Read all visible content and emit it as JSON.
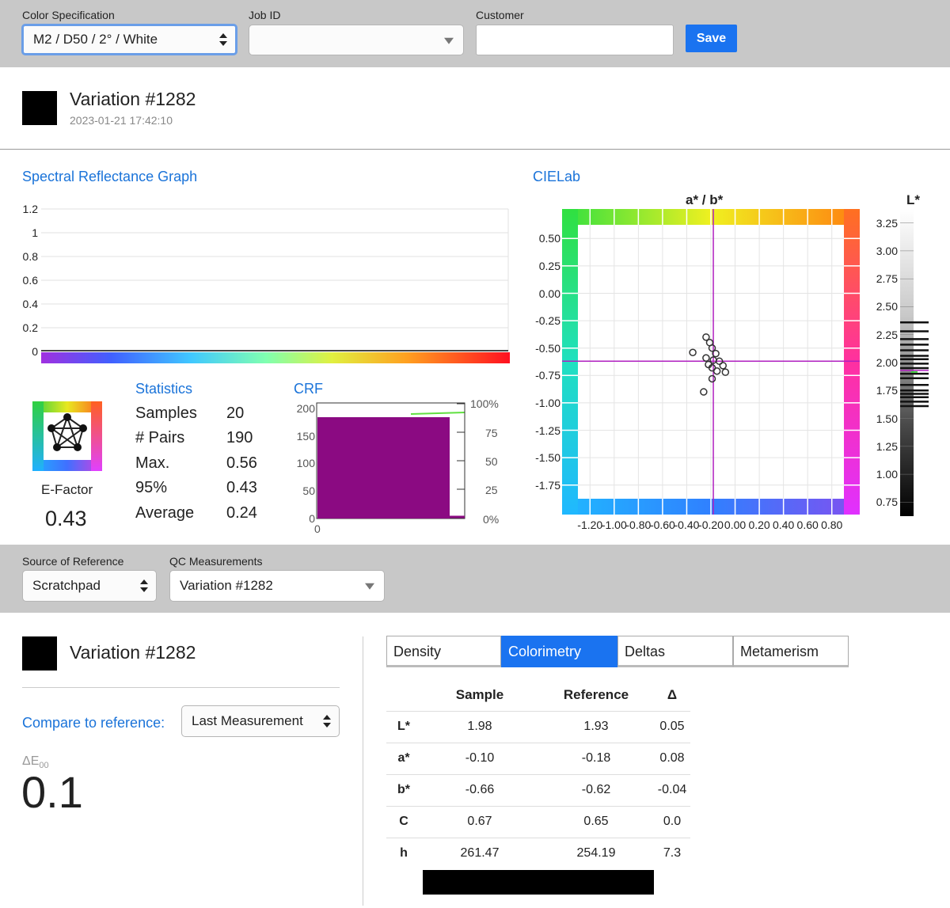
{
  "header": {
    "color_spec": {
      "label": "Color Specification",
      "value": "M2 / D50 / 2° / White"
    },
    "job_id": {
      "label": "Job ID",
      "value": ""
    },
    "customer": {
      "label": "Customer",
      "value": ""
    },
    "save_label": "Save"
  },
  "variation": {
    "name": "Variation #1282",
    "timestamp": "2023-01-21 17:42:10",
    "color": "#000000"
  },
  "spectral": {
    "title": "Spectral Reflectance Graph",
    "y_ticks": [
      "1.2",
      "1",
      "0.8",
      "0.6",
      "0.4",
      "0.2",
      "0"
    ]
  },
  "efactor": {
    "label": "E-Factor",
    "value": "0.43"
  },
  "statistics": {
    "title": "Statistics",
    "rows": [
      {
        "label": "Samples",
        "value": "20"
      },
      {
        "label": "# Pairs",
        "value": "190"
      },
      {
        "label": "Max.",
        "value": "0.56"
      },
      {
        "label": "95%",
        "value": "0.43"
      },
      {
        "label": "Average",
        "value": "0.24"
      }
    ]
  },
  "crf": {
    "title": "CRF",
    "left_ticks": [
      "200",
      "150",
      "100",
      "50",
      "0"
    ],
    "right_ticks": [
      "100%",
      "75",
      "50",
      "25",
      "0%"
    ],
    "x_tick": "0",
    "fill_color": "#8b0a82"
  },
  "cielab": {
    "title": "CIELab",
    "ab_title": "a* / b*",
    "l_title": "L*",
    "b_ticks": [
      "0.50",
      "0.25",
      "0.00",
      "-0.25",
      "-0.50",
      "-0.75",
      "-1.00",
      "-1.25",
      "-1.50",
      "-1.75"
    ],
    "a_ticks": [
      "-1.20",
      "-1.00",
      "-0.80",
      "-0.60",
      "-0.40",
      "-0.20",
      "0.00",
      "0.20",
      "0.40",
      "0.60",
      "0.80"
    ],
    "l_ticks": [
      "3.25",
      "3.00",
      "2.75",
      "2.50",
      "2.25",
      "2.00",
      "1.75",
      "1.50",
      "1.25",
      "1.00",
      "0.75"
    ],
    "crosshair": {
      "a": -0.18,
      "b": -0.62,
      "L": 1.93
    },
    "points": [
      {
        "a": -0.24,
        "b": -0.4
      },
      {
        "a": -0.21,
        "b": -0.45
      },
      {
        "a": -0.19,
        "b": -0.5
      },
      {
        "a": -0.35,
        "b": -0.54
      },
      {
        "a": -0.16,
        "b": -0.55
      },
      {
        "a": -0.24,
        "b": -0.59
      },
      {
        "a": -0.18,
        "b": -0.61
      },
      {
        "a": -0.13,
        "b": -0.62
      },
      {
        "a": -0.22,
        "b": -0.65
      },
      {
        "a": -0.1,
        "b": -0.66
      },
      {
        "a": -0.19,
        "b": -0.68
      },
      {
        "a": -0.15,
        "b": -0.71
      },
      {
        "a": -0.08,
        "b": -0.72
      },
      {
        "a": -0.19,
        "b": -0.78
      },
      {
        "a": -0.26,
        "b": -0.9
      }
    ],
    "l_lines": [
      2.36,
      2.28,
      2.21,
      2.16,
      2.11,
      2.06,
      2.03,
      1.99,
      1.95,
      1.9,
      1.86,
      1.8,
      1.75,
      1.72,
      1.69,
      1.65,
      1.61
    ]
  },
  "reference": {
    "source": {
      "label": "Source of Reference",
      "value": "Scratchpad"
    },
    "qc": {
      "label": "QC Measurements",
      "value": "Variation #1282"
    }
  },
  "compare": {
    "name": "Variation #1282",
    "compare_label": "Compare to reference:",
    "compare_value": "Last Measurement",
    "de_label": "ΔE",
    "de_sub": "00",
    "de_value": "0.1"
  },
  "tabs": [
    {
      "label": "Density",
      "active": false
    },
    {
      "label": "Colorimetry",
      "active": true
    },
    {
      "label": "Deltas",
      "active": false
    },
    {
      "label": "Metamerism",
      "active": false
    }
  ],
  "colorimetry": {
    "headers": [
      "",
      "Sample",
      "Reference",
      "Δ"
    ],
    "rows": [
      [
        "L*",
        "1.98",
        "1.93",
        "0.05"
      ],
      [
        "a*",
        "-0.10",
        "-0.18",
        "0.08"
      ],
      [
        "b*",
        "-0.66",
        "-0.62",
        "-0.04"
      ],
      [
        "C",
        "0.67",
        "0.65",
        "0.0"
      ],
      [
        "h",
        "261.47",
        "254.19",
        "7.3"
      ]
    ]
  }
}
